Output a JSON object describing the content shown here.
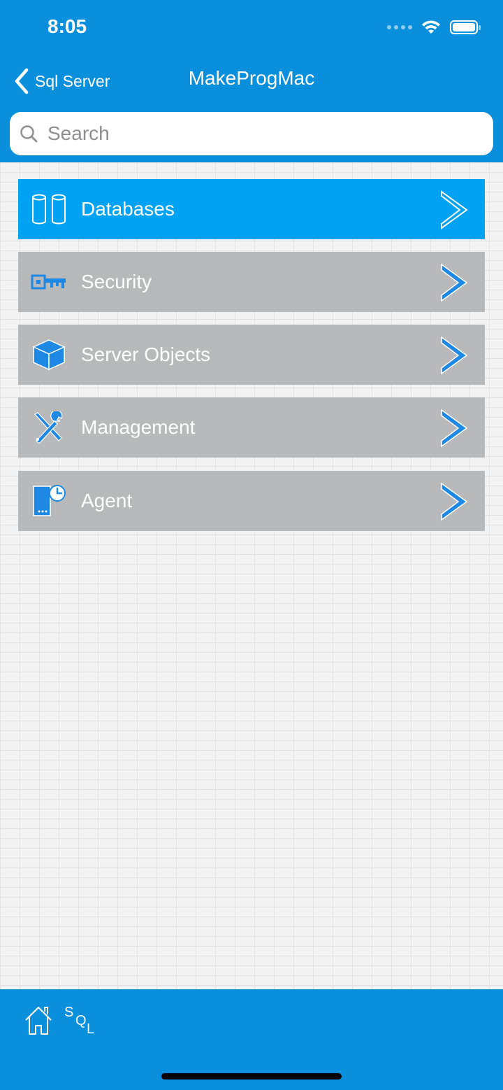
{
  "status_bar": {
    "time": "8:05"
  },
  "nav": {
    "back_label": "Sql Server",
    "title": "MakeProgMac"
  },
  "search": {
    "placeholder": "Search",
    "value": ""
  },
  "menu": {
    "items": [
      {
        "label": "Databases",
        "icon": "database-icon",
        "selected": true
      },
      {
        "label": "Security",
        "icon": "key-icon",
        "selected": false
      },
      {
        "label": "Server Objects",
        "icon": "cube-icon",
        "selected": false
      },
      {
        "label": "Management",
        "icon": "tools-icon",
        "selected": false
      },
      {
        "label": "Agent",
        "icon": "agent-icon",
        "selected": false
      }
    ]
  },
  "tabbar": {
    "items": [
      {
        "icon": "home-icon"
      },
      {
        "icon": "sql-icon",
        "letters": [
          "S",
          "Q",
          "L"
        ]
      }
    ]
  },
  "colors": {
    "header": "#0a8fdc",
    "row_selected": "#00a2f4",
    "row_default": "#b8b9ba",
    "icon_blue": "#1e88e5"
  }
}
